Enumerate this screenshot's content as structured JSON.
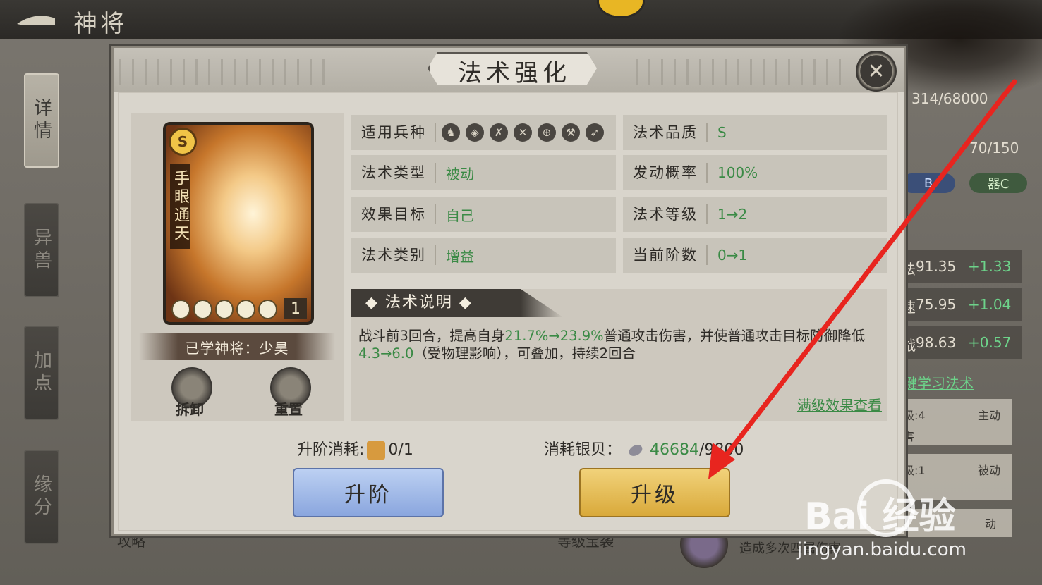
{
  "topbar": {
    "title": "神将"
  },
  "side_tabs": [
    "详情",
    "异兽",
    "加点",
    "缘分"
  ],
  "right_panel": {
    "stat_top": "314/68000",
    "stat_mid": "70/150",
    "tag_b": "B",
    "tag_c": "器C",
    "stats": [
      {
        "label": "法",
        "value": "91.35",
        "delta": "+1.33"
      },
      {
        "label": "速",
        "value": "75.95",
        "delta": "+1.04"
      },
      {
        "label": "战",
        "value": "98.63",
        "delta": "+0.57"
      }
    ],
    "learn_link": "键学习法术",
    "cards": [
      {
        "line1": "级:4",
        "type": "主动",
        "line2": "害"
      },
      {
        "line1": "级:1",
        "type": "被动"
      },
      {
        "type": "动"
      }
    ]
  },
  "bottom": {
    "left_text": "攻略",
    "mid_text": "等级宝袭",
    "right_text": "造成多次四属伤害"
  },
  "modal": {
    "title": "法术强化",
    "card": {
      "grade": "S",
      "name": "手眼通天",
      "level": "1"
    },
    "learned": "已学神将：少昊",
    "dismantle_label": "拆卸",
    "reset_label": "重置",
    "info": [
      {
        "label": "适用兵种",
        "value": ""
      },
      {
        "label": "法术品质",
        "value": "S"
      },
      {
        "label": "法术类型",
        "value": "被动"
      },
      {
        "label": "发动概率",
        "value": "100%"
      },
      {
        "label": "效果目标",
        "value": "自己"
      },
      {
        "label": "法术等级",
        "value": "1→2"
      },
      {
        "label": "法术类别",
        "value": "增益"
      },
      {
        "label": "当前阶数",
        "value": "0→1"
      }
    ],
    "desc_title": "法术说明",
    "desc": {
      "p1": "战斗前3回合，提高自身",
      "h1": "21.7%→23.9%",
      "p2": "普通攻击伤害，并使普通攻击目标防御降低",
      "h2": "4.3→6.0",
      "p3": "（受物理影响），可叠加，持续2回合"
    },
    "full_effect_link": "满级效果查看",
    "advance_cost_label": "升阶消耗:",
    "advance_cost_value": "0/1",
    "silver_label": "消耗银贝：",
    "silver_have": "46684",
    "silver_need": "/9800",
    "advance_button": "升阶",
    "upgrade_button": "升级"
  },
  "watermark": {
    "brand": "Bai 经验",
    "url": "jingyan.baidu.com"
  },
  "colors": {
    "accent_green": "#3a8a45",
    "arrow_red": "#e8251f"
  }
}
